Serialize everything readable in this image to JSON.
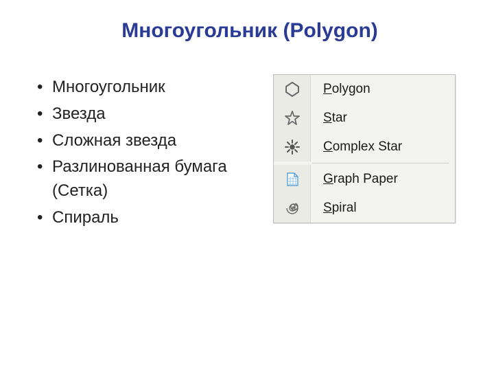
{
  "title": "Многоугольник (Polygon)",
  "bullets": [
    "Многоугольник",
    "Звезда",
    "Сложная звезда",
    "Разлинованная бумага (Сетка)",
    "Спираль"
  ],
  "menu": {
    "items": [
      {
        "icon": "polygon-icon",
        "label_pre": "",
        "mnemonic": "P",
        "label_post": "olygon"
      },
      {
        "icon": "star-icon",
        "label_pre": "",
        "mnemonic": "S",
        "label_post": "tar"
      },
      {
        "icon": "complex-star-icon",
        "label_pre": "",
        "mnemonic": "C",
        "label_post": "omplex Star"
      }
    ],
    "items2": [
      {
        "icon": "graph-paper-icon",
        "label_pre": "",
        "mnemonic": "G",
        "label_post": "raph Paper"
      },
      {
        "icon": "spiral-icon",
        "label_pre": "",
        "mnemonic": "S",
        "label_post": "piral"
      }
    ]
  }
}
